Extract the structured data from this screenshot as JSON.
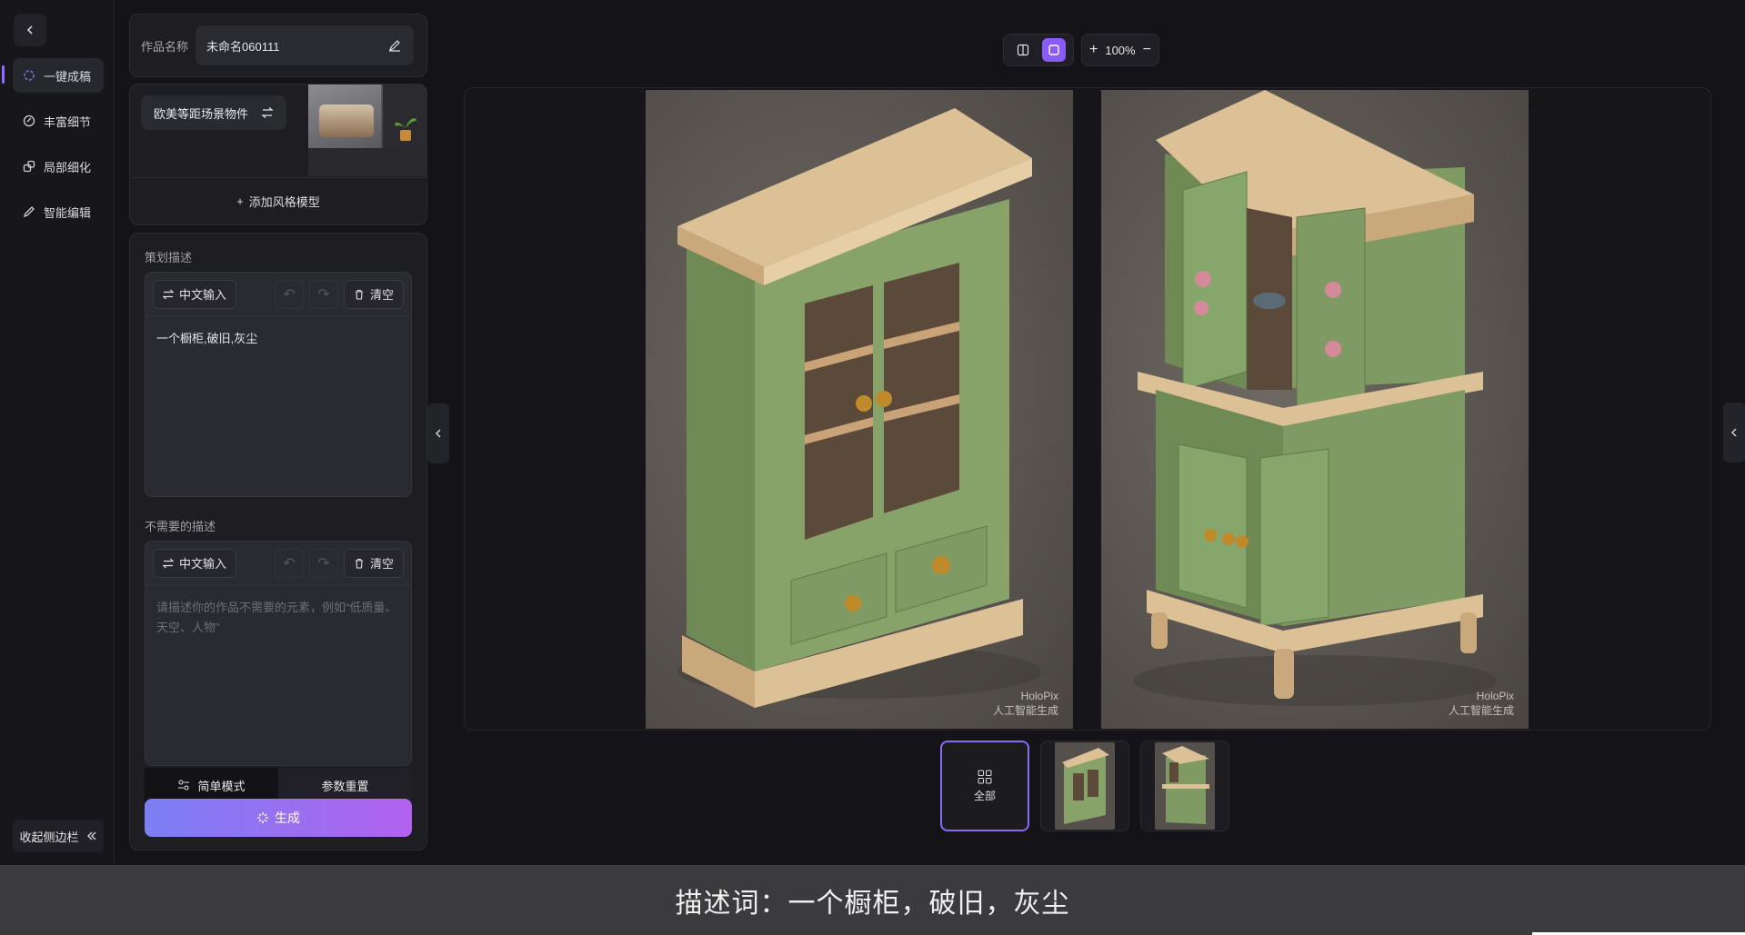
{
  "rail": {
    "items": [
      {
        "label": "一键成稿",
        "icon": "sparkle-icon"
      },
      {
        "label": "丰富细节",
        "icon": "detail-icon"
      },
      {
        "label": "局部细化",
        "icon": "region-icon"
      },
      {
        "label": "智能编辑",
        "icon": "pen-icon"
      }
    ],
    "collapse_label": "收起侧边栏"
  },
  "work": {
    "name_label": "作品名称",
    "name_value": "未命名060111"
  },
  "style": {
    "chip_label": "欧美等距场景物件",
    "add_label": "添加风格模型"
  },
  "prompt": {
    "title": "策划描述",
    "input_mode": "中文输入",
    "clear_label": "清空",
    "value": "一个橱柜,破旧,灰尘"
  },
  "negative": {
    "title": "不需要的描述",
    "input_mode": "中文输入",
    "clear_label": "清空",
    "placeholder": "请描述你的作品不需要的元素，例如“低质量、天空、人物”"
  },
  "actions": {
    "simple_mode": "简单模式",
    "reset": "参数重置",
    "generate": "生成"
  },
  "toolbar": {
    "zoom": "100%"
  },
  "images": [
    {
      "brand": "HoloPix",
      "sub": "人工智能生成"
    },
    {
      "brand": "HoloPix",
      "sub": "人工智能生成"
    }
  ],
  "thumbs": {
    "all_label": "全部"
  },
  "caption": "描述词：一个橱柜，破旧，灰尘",
  "colors": {
    "accent": "#8a5cf6",
    "cabinet_green": "#7f9a62",
    "wood": "#dcc196"
  }
}
